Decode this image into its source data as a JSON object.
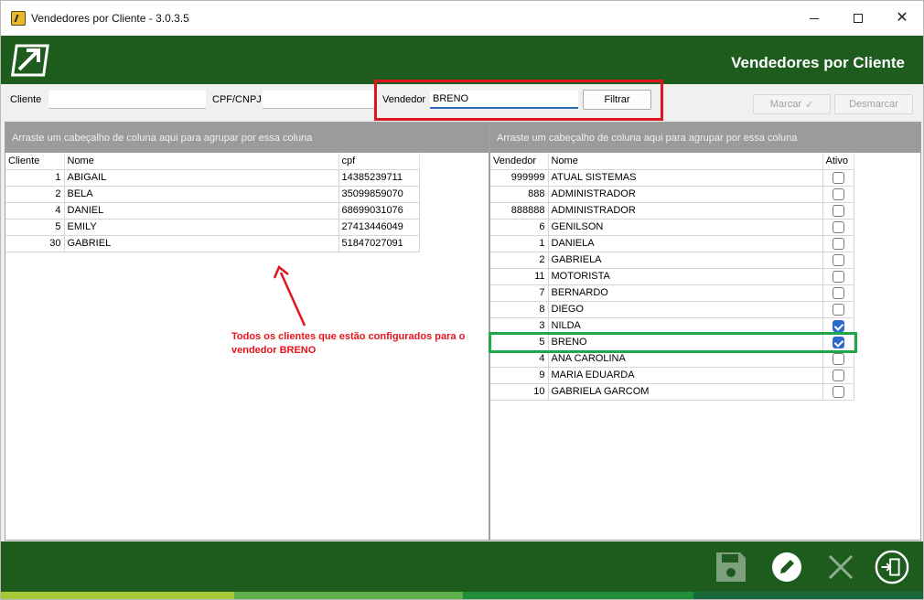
{
  "window": {
    "title": "Vendedores por Cliente - 3.0.3.5"
  },
  "header": {
    "title": "Vendedores por Cliente"
  },
  "filters": {
    "cliente_label": "Cliente",
    "cliente_value": "",
    "cpf_label": "CPF/CNPJ",
    "cpf_value": "",
    "vendedor_label": "Vendedor",
    "vendedor_value": "BRENO",
    "filtrar_label": "Filtrar",
    "marcar_label": "Marcar",
    "desmarcar_label": "Desmarcar"
  },
  "left_grid": {
    "group_hint": "Arraste um cabeçalho de coluna aqui para agrupar por essa coluna",
    "columns": [
      "Cliente",
      "Nome",
      "cpf"
    ],
    "rows": [
      {
        "id": "1",
        "nome": "ABIGAIL",
        "cpf": "14385239711"
      },
      {
        "id": "2",
        "nome": "BELA",
        "cpf": "35099859070"
      },
      {
        "id": "4",
        "nome": "DANIEL",
        "cpf": "68699031076"
      },
      {
        "id": "5",
        "nome": "EMILY",
        "cpf": "27413446049"
      },
      {
        "id": "30",
        "nome": "GABRIEL",
        "cpf": "51847027091"
      }
    ]
  },
  "right_grid": {
    "group_hint": "Arraste um cabeçalho de coluna aqui para agrupar por essa coluna",
    "columns": [
      "Vendedor",
      "Nome",
      "Ativo"
    ],
    "rows": [
      {
        "id": "999999",
        "nome": "ATUAL SISTEMAS",
        "ativo": false
      },
      {
        "id": "888",
        "nome": "ADMINISTRADOR",
        "ativo": false
      },
      {
        "id": "888888",
        "nome": "ADMINISTRADOR",
        "ativo": false
      },
      {
        "id": "6",
        "nome": "GENILSON",
        "ativo": false
      },
      {
        "id": "1",
        "nome": "DANIELA",
        "ativo": false
      },
      {
        "id": "2",
        "nome": "GABRIELA",
        "ativo": false
      },
      {
        "id": "11",
        "nome": "MOTORISTA",
        "ativo": false
      },
      {
        "id": "7",
        "nome": "BERNARDO",
        "ativo": false
      },
      {
        "id": "8",
        "nome": "DIEGO",
        "ativo": false
      },
      {
        "id": "3",
        "nome": "NILDA",
        "ativo": true
      },
      {
        "id": "5",
        "nome": "BRENO",
        "ativo": true
      },
      {
        "id": "4",
        "nome": "ANA CAROLINA",
        "ativo": false
      },
      {
        "id": "9",
        "nome": "MARIA EDUARDA",
        "ativo": false
      },
      {
        "id": "10",
        "nome": "GABRIELA GARCOM",
        "ativo": false
      }
    ]
  },
  "annotation": {
    "text": "Todos os clientes que estão configurados para o vendedor BRENO"
  },
  "footer": {
    "icons": [
      "save-icon",
      "edit-icon",
      "cancel-icon",
      "exit-icon"
    ]
  },
  "colors": {
    "brand_green": "#1e5c1e",
    "highlight_red": "#e0141c",
    "highlight_green": "#1ea84a",
    "checkbox_blue": "#2d6ad0",
    "stripes": [
      "#a6c93a",
      "#5bb04a",
      "#1f8f3a",
      "#17693a"
    ]
  }
}
